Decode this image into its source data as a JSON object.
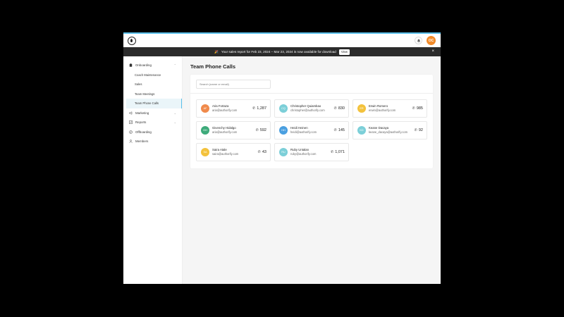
{
  "header": {
    "logo_icon": "droplet-logo-icon",
    "bell_icon": "bell-icon",
    "user_initials": "OC",
    "user_avatar_color": "#f28b2a",
    "accent_color": "#5bc0eb"
  },
  "banner": {
    "emoji": "🎉",
    "text": "Your sales report for Feb 23, 2024 – Mar 23, 2024 is now available for download",
    "view_label": "View",
    "close_glyph": "×"
  },
  "sidebar": {
    "onboarding": {
      "label": "Onboarding",
      "icon": "clipboard-icon"
    },
    "onboarding_items": [
      {
        "label": "Coach Maintenance"
      },
      {
        "label": "Sales"
      },
      {
        "label": "Team Meetings"
      },
      {
        "label": "Team Phone Calls",
        "active": true
      }
    ],
    "items": [
      {
        "label": "Marketing",
        "icon": "megaphone-icon",
        "expandable": true
      },
      {
        "label": "Reports",
        "icon": "chart-icon",
        "expandable": true
      },
      {
        "label": "Offboarding",
        "icon": "compass-icon",
        "expandable": false
      },
      {
        "label": "Members",
        "icon": "users-icon",
        "expandable": false
      }
    ]
  },
  "main": {
    "title": "Team Phone Calls",
    "search_placeholder": "Search (name or email)",
    "people": [
      {
        "initials": "AF",
        "name": "Aria Fortaza",
        "email": "aria@authorify.com",
        "calls": "1,287",
        "color": "#f08a4b"
      },
      {
        "initials": "CQ",
        "name": "Christopher Quiambao",
        "email": "christopher@authorify.com",
        "calls": "830",
        "color": "#7ccfd8"
      },
      {
        "initials": "ER",
        "name": "Erwin Romero",
        "email": "erwin@authorify.com",
        "calls": "985",
        "color": "#f3c23c"
      },
      {
        "initials": "GH",
        "name": "Givenchy Hidalgo",
        "email": "aria@authorify.com",
        "calls": "592",
        "color": "#3daa7a"
      },
      {
        "initials": "HH",
        "name": "Heidi Heinen",
        "email": "heidi@authorify.com",
        "calls": "145",
        "color": "#4a9fe0"
      },
      {
        "initials": "KD",
        "name": "Keane Dacaya",
        "email": "keane_dacaya@authorify.com",
        "calls": "92",
        "color": "#7ccfd8"
      },
      {
        "initials": "SA",
        "name": "Saira Atale",
        "email": "saira@authorify.com",
        "calls": "43",
        "color": "#f3c23c"
      },
      {
        "initials": "RU",
        "name": "Ruby Untalan",
        "email": "ruby@authorify.com",
        "calls": "1,071",
        "color": "#7ccfd8"
      }
    ]
  }
}
